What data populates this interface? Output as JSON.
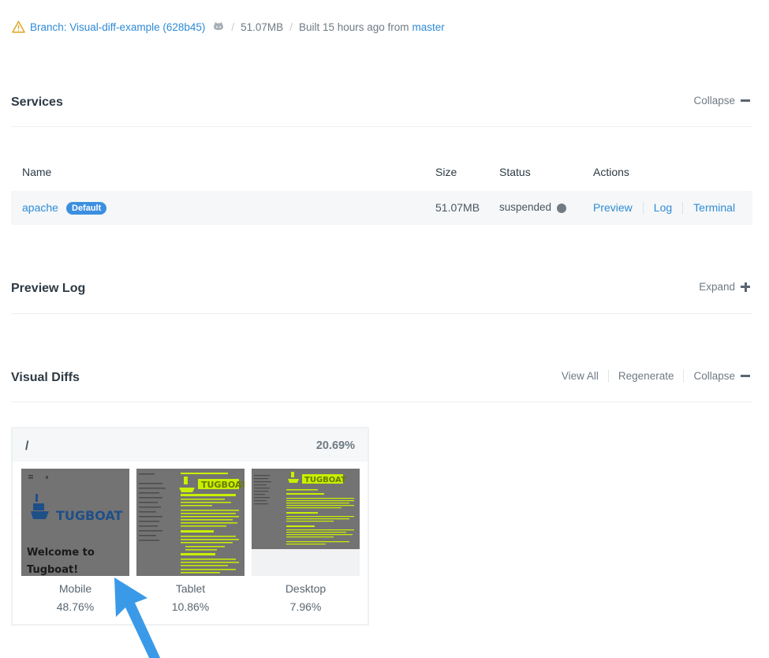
{
  "topbar": {
    "branch_label": "Branch: Visual-diff-example (628b45)",
    "size": "51.07MB",
    "built_prefix": "Built 15 hours ago from",
    "built_ref": "master",
    "icons": [
      "warning-icon",
      "github-icon"
    ]
  },
  "services": {
    "title": "Services",
    "collapse_label": "Collapse",
    "columns": {
      "name": "Name",
      "size": "Size",
      "status": "Status",
      "actions": "Actions"
    },
    "rows": [
      {
        "name": "apache",
        "badge": "Default",
        "size": "51.07MB",
        "status": "suspended",
        "actions": [
          "Preview",
          "Log",
          "Terminal"
        ]
      }
    ]
  },
  "preview_log": {
    "title": "Preview Log",
    "expand_label": "Expand"
  },
  "visual_diffs": {
    "title": "Visual Diffs",
    "view_all_label": "View All",
    "regenerate_label": "Regenerate",
    "collapse_label": "Collapse",
    "card": {
      "path": "/",
      "overall_pct": "20.69%",
      "thumbs": [
        {
          "name": "Mobile",
          "pct": "48.76%",
          "caption": "Welcome to Tugboat!",
          "logo": "TUGBOAT"
        },
        {
          "name": "Tablet",
          "pct": "10.86%",
          "logo": "TUGBOAT",
          "caption": "Welcome to Tugboat!"
        },
        {
          "name": "Desktop",
          "pct": "7.96%",
          "logo": "TUGBOAT"
        }
      ]
    }
  },
  "colors": {
    "link": "#2f8bd6",
    "badge": "#3b8fe0",
    "diff_highlight": "#c8f000",
    "arrow": "#3a9ae8"
  }
}
